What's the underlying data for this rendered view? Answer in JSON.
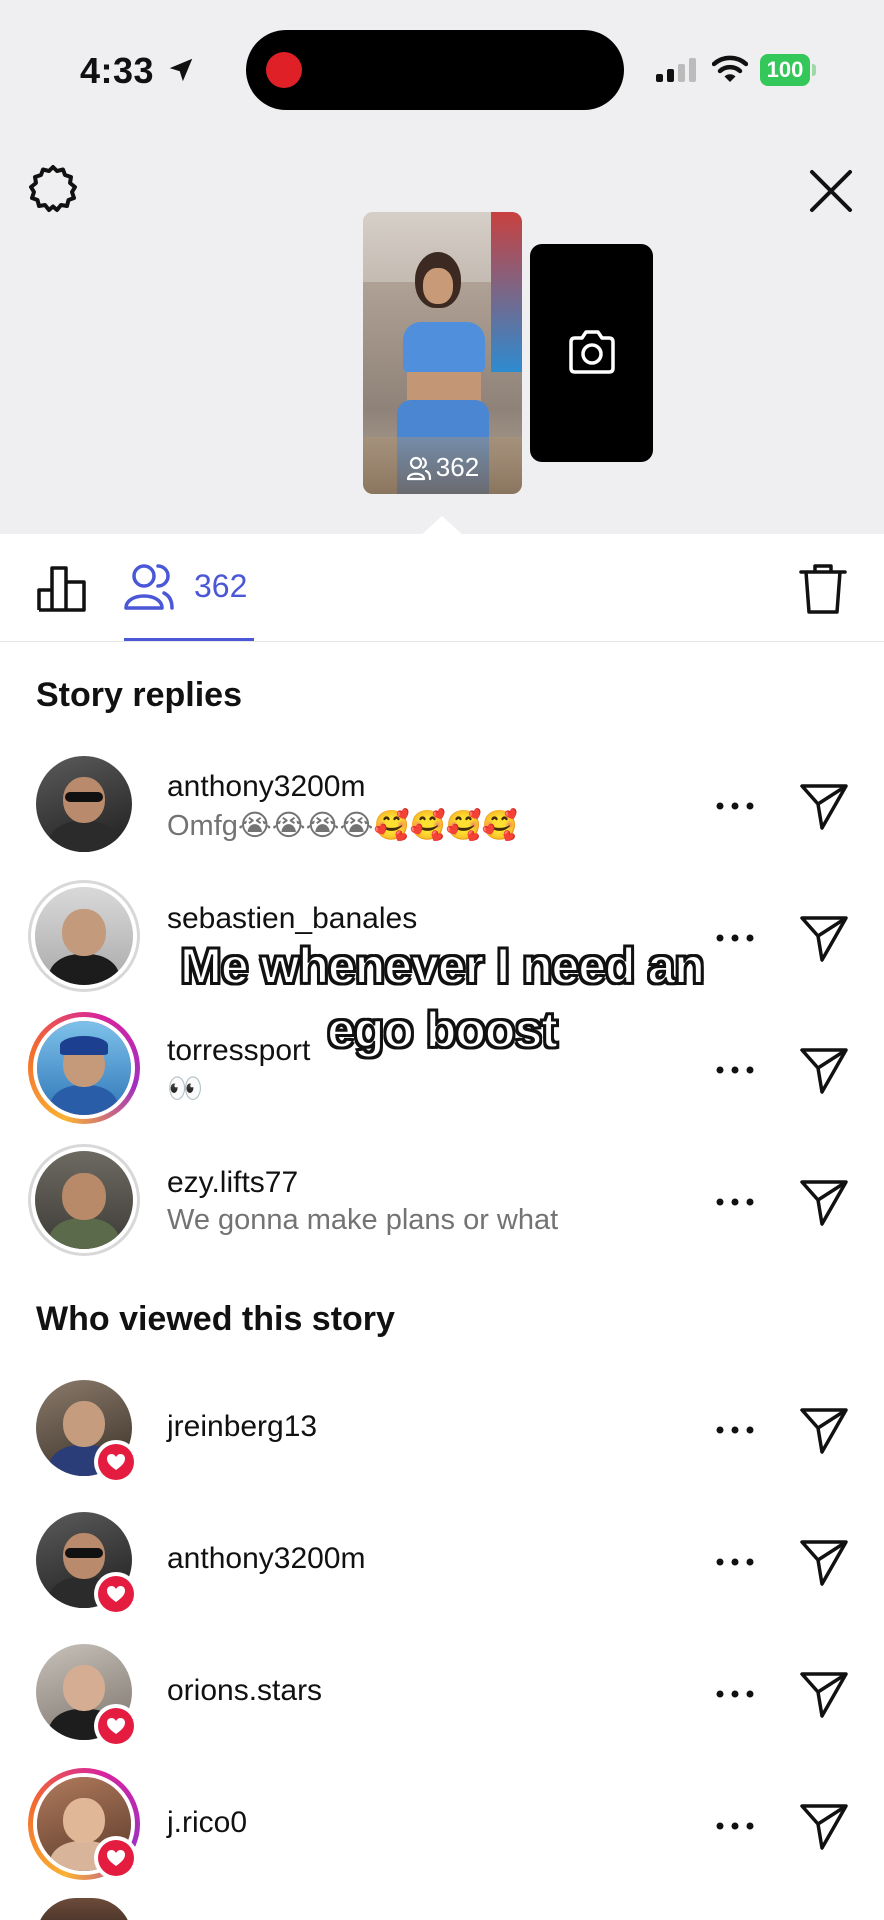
{
  "status_bar": {
    "time": "4:33",
    "battery": "100"
  },
  "story_preview": {
    "viewer_count": "362",
    "thumb_caption": ""
  },
  "tabs": {
    "viewers_count": "362"
  },
  "replies_section": {
    "title": "Story replies",
    "items": [
      {
        "username": "anthony3200m",
        "reply": "Omfg😭😭😭😭🥰🥰🥰🥰"
      },
      {
        "username": "sebastien_banales",
        "reply": ""
      },
      {
        "username": "torressport",
        "reply": "👀"
      },
      {
        "username": "ezy.lifts77",
        "reply": "We gonna make plans or what"
      }
    ]
  },
  "viewers_section": {
    "title": "Who viewed this story",
    "items": [
      {
        "username": "jreinberg13"
      },
      {
        "username": "anthony3200m"
      },
      {
        "username": "orions.stars"
      },
      {
        "username": "j.rico0"
      }
    ]
  },
  "overlay_caption": {
    "line1": "Me whenever I need an",
    "line2": "ego boost"
  },
  "colors": {
    "accent": "#4a57d6",
    "like": "#e41c40",
    "battery": "#34c759",
    "recording": "#e02027"
  }
}
